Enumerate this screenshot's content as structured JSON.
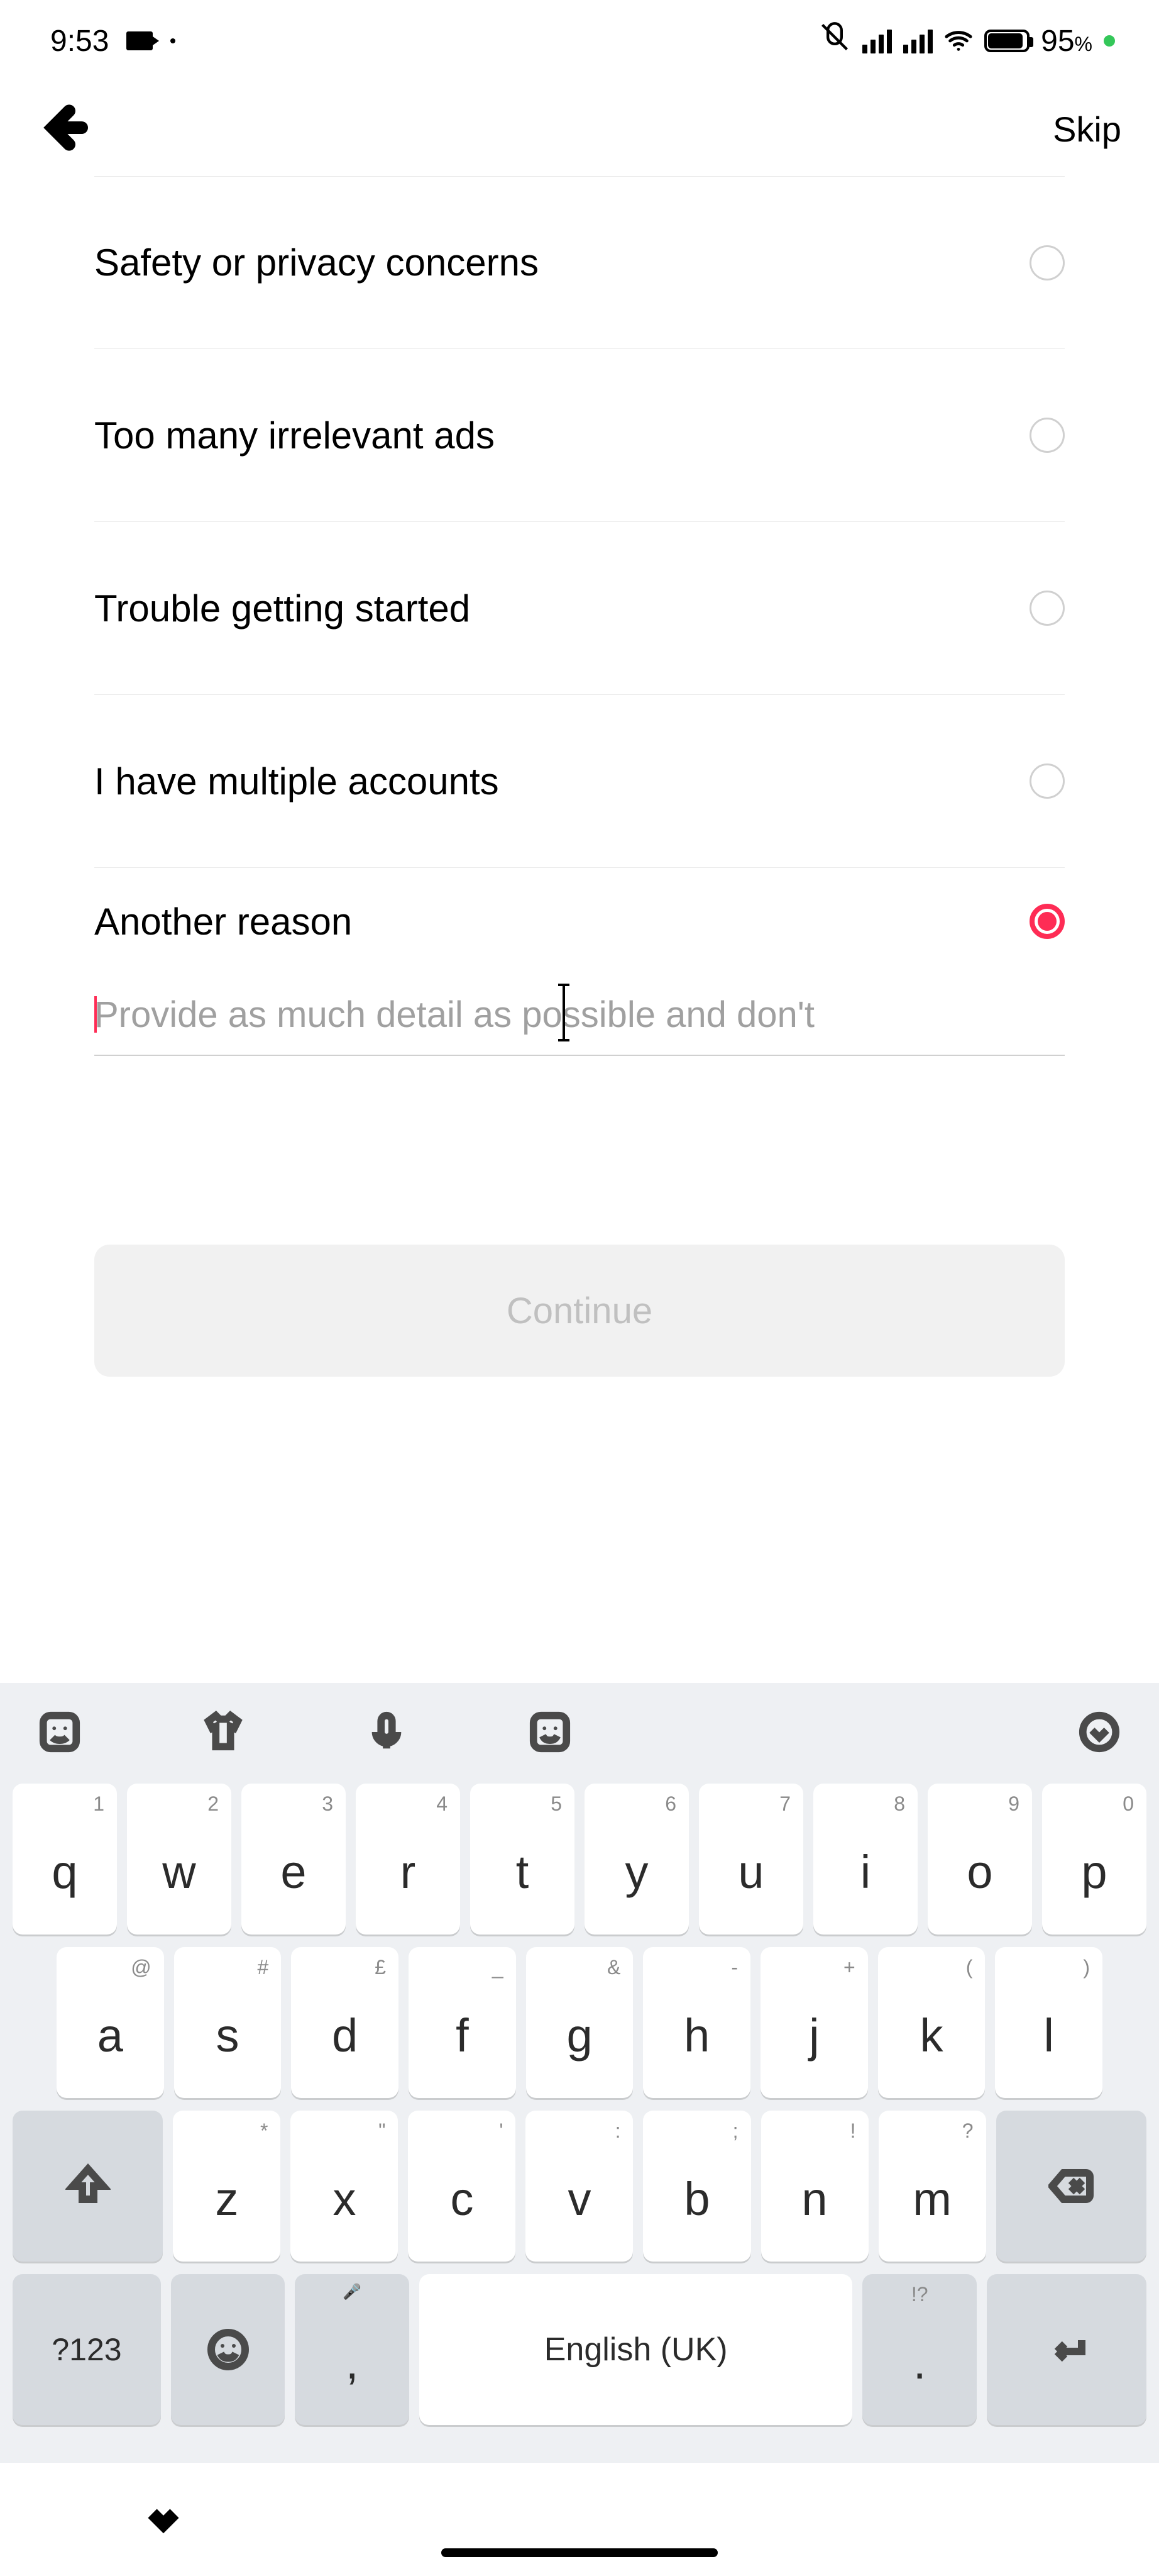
{
  "status": {
    "time": "9:53",
    "battery_pct": "95",
    "battery_suffix": "%"
  },
  "header": {
    "skip": "Skip"
  },
  "options": [
    {
      "label": "Safety or privacy concerns",
      "selected": false
    },
    {
      "label": "Too many irrelevant ads",
      "selected": false
    },
    {
      "label": "Trouble getting started",
      "selected": false
    },
    {
      "label": "I have multiple accounts",
      "selected": false
    },
    {
      "label": "Another reason",
      "selected": true
    }
  ],
  "detail": {
    "placeholder": "Provide as much detail as possible and don't",
    "value": ""
  },
  "continue_label": "Continue",
  "keyboard": {
    "row1": [
      {
        "m": "q",
        "s": "1"
      },
      {
        "m": "w",
        "s": "2"
      },
      {
        "m": "e",
        "s": "3"
      },
      {
        "m": "r",
        "s": "4"
      },
      {
        "m": "t",
        "s": "5"
      },
      {
        "m": "y",
        "s": "6"
      },
      {
        "m": "u",
        "s": "7"
      },
      {
        "m": "i",
        "s": "8"
      },
      {
        "m": "o",
        "s": "9"
      },
      {
        "m": "p",
        "s": "0"
      }
    ],
    "row2": [
      {
        "m": "a",
        "s": "@"
      },
      {
        "m": "s",
        "s": "#"
      },
      {
        "m": "d",
        "s": "£"
      },
      {
        "m": "f",
        "s": "_"
      },
      {
        "m": "g",
        "s": "&"
      },
      {
        "m": "h",
        "s": "-"
      },
      {
        "m": "j",
        "s": "+"
      },
      {
        "m": "k",
        "s": "("
      },
      {
        "m": "l",
        "s": ")"
      }
    ],
    "row3": [
      {
        "m": "z",
        "s": "*"
      },
      {
        "m": "x",
        "s": "\""
      },
      {
        "m": "c",
        "s": "'"
      },
      {
        "m": "v",
        "s": ":"
      },
      {
        "m": "b",
        "s": ";"
      },
      {
        "m": "n",
        "s": "!"
      },
      {
        "m": "m",
        "s": "?"
      }
    ],
    "symkey": "?123",
    "spacebar": "English (UK)",
    "comma": ",",
    "period": ".",
    "period_sec": "!?",
    "comma_sec": "🎤"
  }
}
